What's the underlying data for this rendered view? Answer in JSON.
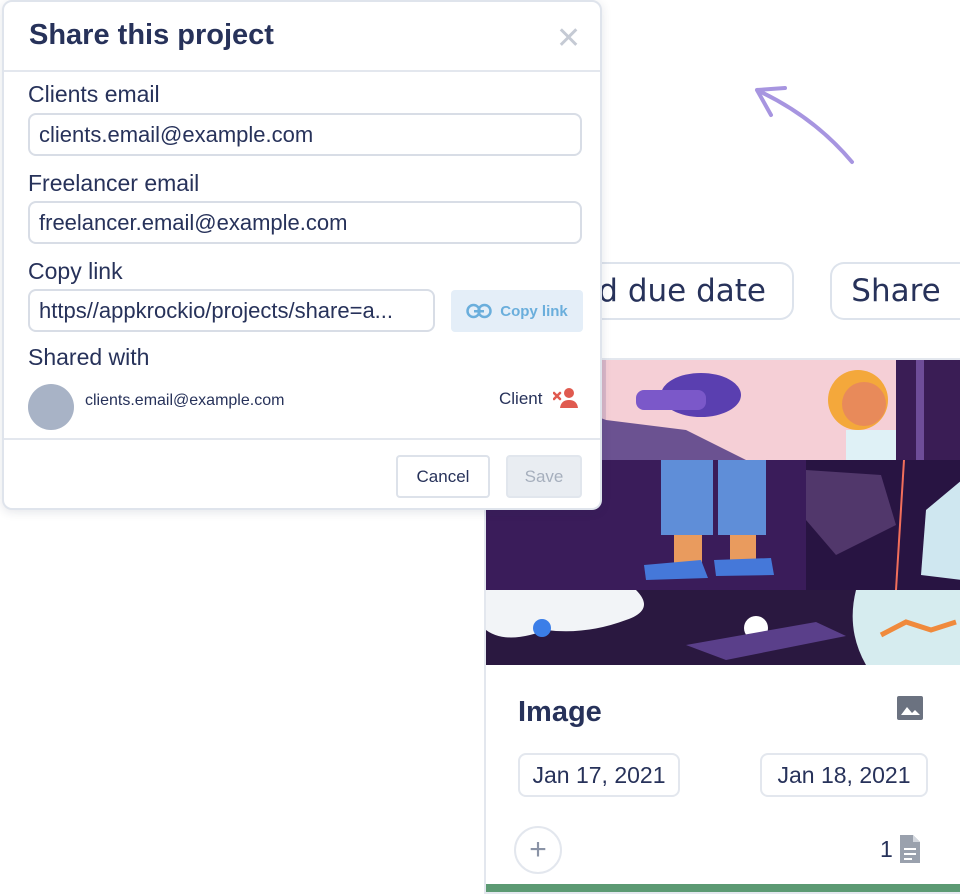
{
  "background": {
    "due_date_button": "dd due date",
    "share_button": "Share",
    "arrow_icon": "curved-arrow-icon",
    "arrow_color": "#a795e0"
  },
  "card": {
    "title": "Image",
    "start_date": "Jan 17, 2021",
    "end_date": "Jan 18, 2021",
    "file_count": "1",
    "type_icon": "image-icon",
    "accent_color": "#5c9a73"
  },
  "modal": {
    "title": "Share this project",
    "clients_email": {
      "label": "Clients email",
      "value": "clients.email@example.com"
    },
    "freelancer_email": {
      "label": "Freelancer email",
      "value": "freelancer.email@example.com"
    },
    "copy_link": {
      "label": "Copy link",
      "value": "https//appkrockio/projects/share=a...",
      "button_label": "Copy link"
    },
    "shared_with": {
      "label": "Shared with",
      "users": [
        {
          "email": "clients.email@example.com",
          "role": "Client"
        }
      ]
    },
    "cancel_label": "Cancel",
    "save_label": "Save"
  }
}
